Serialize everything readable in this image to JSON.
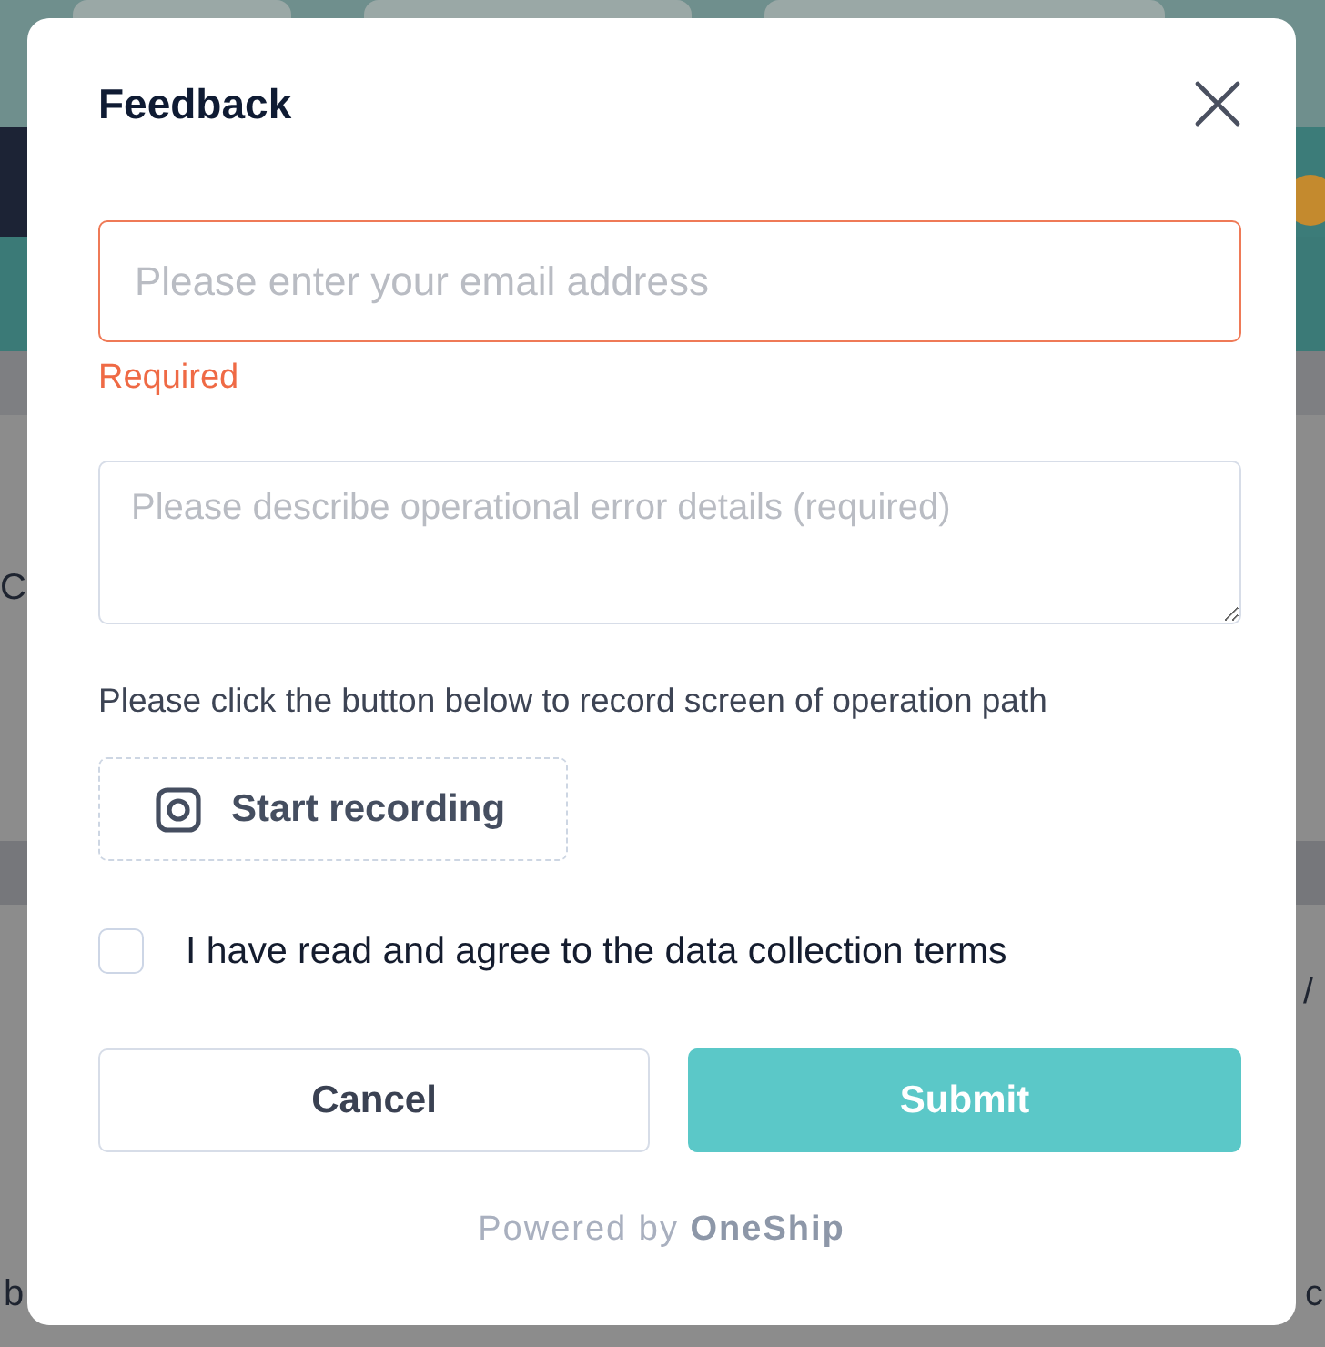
{
  "background": {
    "fragments": [
      {
        "text": "C"
      },
      {
        "text": "b"
      },
      {
        "text": "/"
      },
      {
        "text": "c"
      }
    ]
  },
  "dialog": {
    "title": "Feedback",
    "email": {
      "placeholder": "Please enter your email address",
      "error": "Required"
    },
    "details": {
      "placeholder": "Please describe operational error details (required)"
    },
    "instructions": "Please click the button below to record screen of operation path",
    "record_button": "Start recording",
    "agree": {
      "label": "I have read and agree to the data collection terms",
      "checked": false
    },
    "buttons": [
      {
        "label": "Cancel",
        "kind": "secondary"
      },
      {
        "label": "Submit",
        "kind": "primary"
      }
    ],
    "footer": "Powered by **OneShip**"
  }
}
